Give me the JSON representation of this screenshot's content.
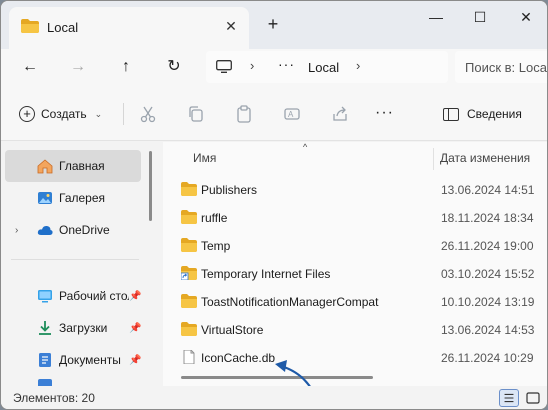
{
  "tab": {
    "title": "Local"
  },
  "window_controls": {
    "minimize": "—",
    "maximize": "☐",
    "close": "✕"
  },
  "nav": {
    "back": "←",
    "forward": "→",
    "up": "↑",
    "refresh": "↻"
  },
  "address": {
    "ellipsis": "···",
    "current": "Local"
  },
  "search": {
    "placeholder": "Поиск в: Local"
  },
  "commands": {
    "create_label": "Создать",
    "more": "···",
    "details_label": "Сведения"
  },
  "sidebar": {
    "items": [
      {
        "label": "Главная",
        "icon": "home-icon"
      },
      {
        "label": "Галерея",
        "icon": "gallery-icon"
      },
      {
        "label": "OneDrive",
        "icon": "cloud-icon"
      },
      {
        "label": "Рабочий стол",
        "icon": "desktop-icon"
      },
      {
        "label": "Загрузки",
        "icon": "download-icon"
      },
      {
        "label": "Документы",
        "icon": "documents-icon"
      }
    ]
  },
  "columns": {
    "name": "Имя",
    "date": "Дата изменения"
  },
  "files": [
    {
      "name": "Publishers",
      "date": "13.06.2024 14:51",
      "type": "folder"
    },
    {
      "name": "ruffle",
      "date": "18.11.2024 18:34",
      "type": "folder"
    },
    {
      "name": "Temp",
      "date": "26.11.2024 19:00",
      "type": "folder"
    },
    {
      "name": "Temporary Internet Files",
      "date": "03.10.2024 15:52",
      "type": "folder-shortcut"
    },
    {
      "name": "ToastNotificationManagerCompat",
      "date": "10.10.2024 13:19",
      "type": "folder"
    },
    {
      "name": "VirtualStore",
      "date": "13.06.2024 14:53",
      "type": "folder"
    },
    {
      "name": "IconCache.db",
      "date": "26.11.2024 10:29",
      "type": "file"
    }
  ],
  "status": {
    "items_count": "Элементов: 20"
  },
  "colors": {
    "folder": "#f6c544",
    "folder_dark": "#e5a823",
    "accent": "#1e5aa8"
  }
}
